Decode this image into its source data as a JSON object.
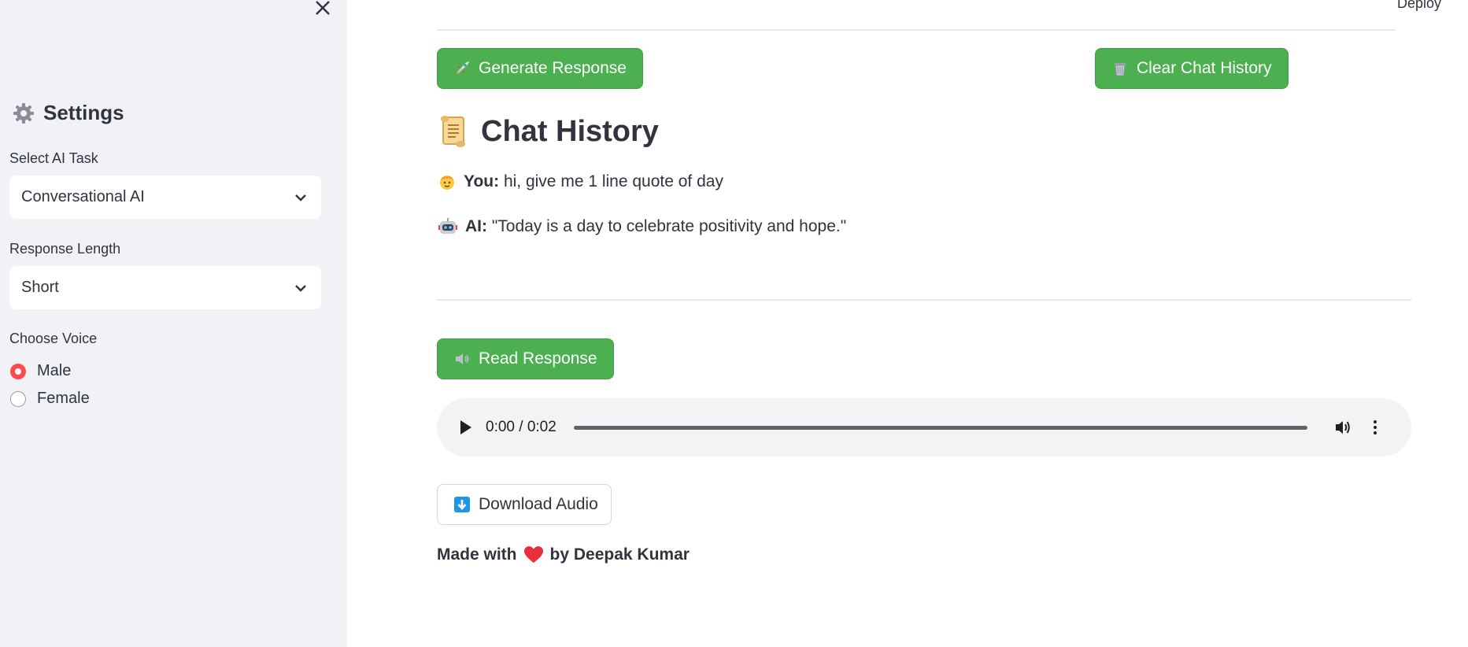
{
  "header": {
    "deploy_label": "Deploy"
  },
  "sidebar": {
    "title": "Settings",
    "task": {
      "label": "Select AI Task",
      "value": "Conversational AI"
    },
    "length": {
      "label": "Response Length",
      "value": "Short"
    },
    "voice": {
      "label": "Choose Voice",
      "options": [
        {
          "label": "Male",
          "selected": true
        },
        {
          "label": "Female",
          "selected": false
        }
      ]
    }
  },
  "main": {
    "generate_label": "Generate Response",
    "clear_label": "Clear Chat History",
    "chat_title": "Chat History",
    "chat": [
      {
        "speaker": "You:",
        "text": "hi, give me 1 line quote of day"
      },
      {
        "speaker": "AI:",
        "text": "\"Today is a day to celebrate positivity and hope.\""
      }
    ],
    "read_label": "Read Response",
    "audio": {
      "time": "0:00 / 0:02",
      "progress": 0
    },
    "download_label": "Download Audio",
    "footer": {
      "prefix": "Made with",
      "suffix": "by Deepak Kumar"
    }
  },
  "colors": {
    "primary_button": "#4caf50",
    "radio_accent": "#ff4b4b",
    "sidebar_bg": "#f0f2f6"
  }
}
